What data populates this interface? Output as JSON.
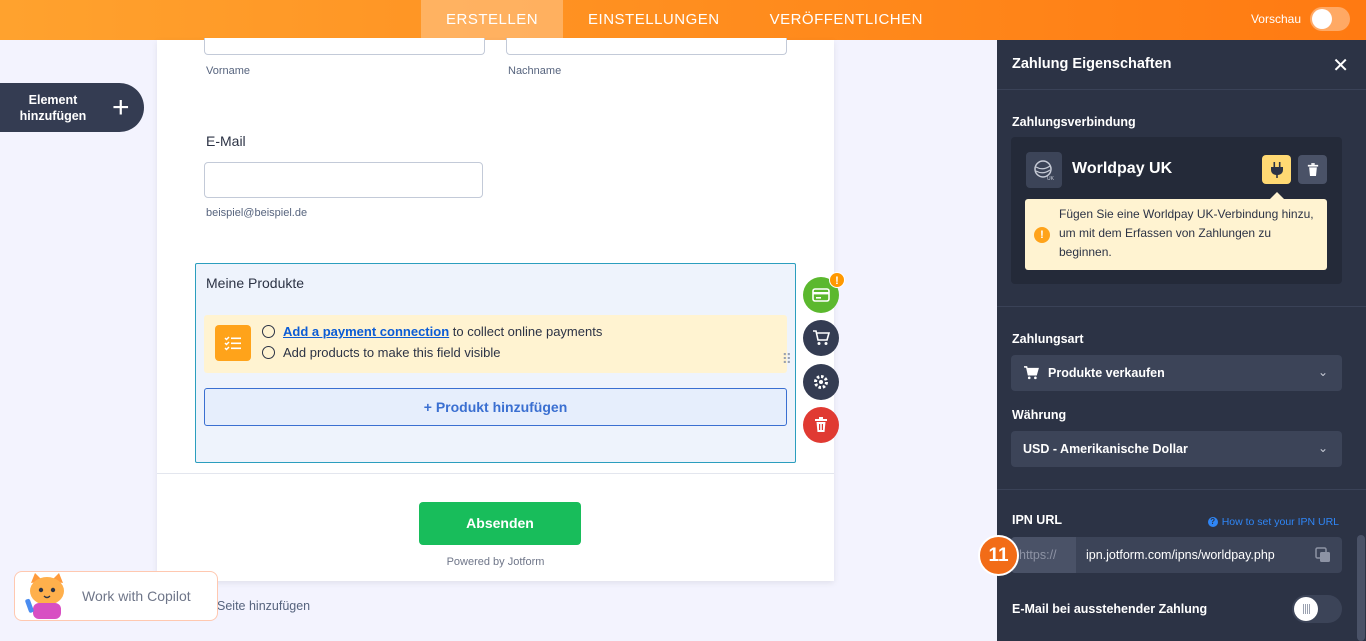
{
  "topbar": {
    "tabs": [
      {
        "label": "ERSTELLEN",
        "active": true
      },
      {
        "label": "EINSTELLUNGEN",
        "active": false
      },
      {
        "label": "VERÖFFENTLICHEN",
        "active": false
      }
    ],
    "preview_label": "Vorschau",
    "preview_on": false
  },
  "left": {
    "add_element_line1": "Element",
    "add_element_line2": "hinzufügen"
  },
  "form": {
    "first_name_sublabel": "Vorname",
    "last_name_sublabel": "Nachname",
    "email_label": "E-Mail",
    "email_sublabel": "beispiel@beispiel.de",
    "products_title": "Meine Produkte",
    "notice_link": "Add a payment connection",
    "notice_line1_rest": " to collect online payments",
    "notice_line2": "Add products to make this field visible",
    "add_product_button": "+ Produkt hinzufügen",
    "submit_button": "Absenden",
    "powered_by": "Powered by Jotform",
    "add_page": "Seite hinzufügen",
    "warning_badge": "!"
  },
  "copilot": {
    "label": "Work with Copilot"
  },
  "panel": {
    "title": "Zahlung Eigenschaften",
    "connection_label": "Zahlungsverbindung",
    "gateway_name": "Worldpay UK",
    "tooltip_text": "Fügen Sie eine Worldpay UK-Verbindung hinzu, um mit dem Erfassen von Zahlungen zu beginnen.",
    "payment_type_label": "Zahlungsart",
    "payment_type_value": "Produkte verkaufen",
    "currency_label": "Währung",
    "currency_value": "USD - Amerikanische Dollar",
    "ipn_label": "IPN URL",
    "ipn_help": "How to set your IPN URL",
    "ipn_prefix": "https://",
    "ipn_url": "ipn.jotform.com/ipns/worldpay.php",
    "email_pending_label": "E-Mail bei ausstehender Zahlung",
    "email_pending_on": false
  },
  "step_badge": "11",
  "colors": {
    "topbar_accent": "#ff8a1c",
    "panel_bg": "#2c3345",
    "submit_green": "#18bd5b",
    "link_blue": "#0b5cd5",
    "notice_bg": "#fff3d1",
    "delete_red": "#e03a32"
  }
}
